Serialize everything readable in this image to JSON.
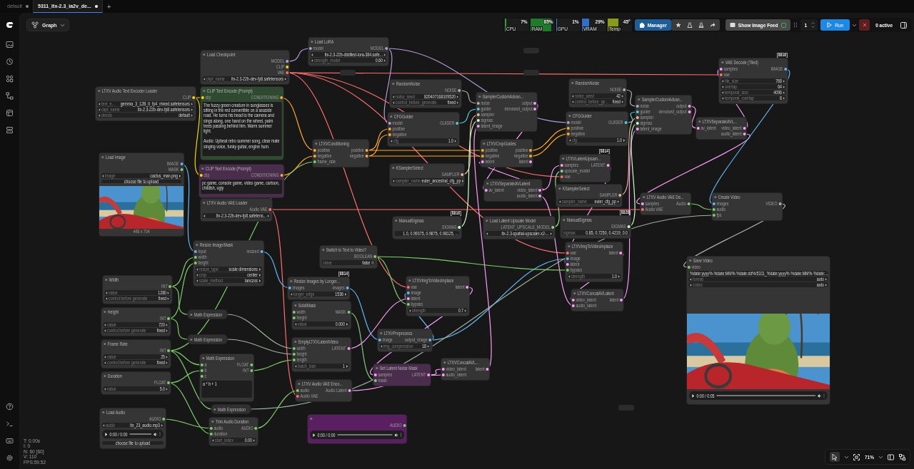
{
  "tabs": [
    {
      "label": "default",
      "selected": false,
      "modified": true
    },
    {
      "label": "5311_ltx-2.3_ia2v_de...",
      "selected": true,
      "modified": true
    }
  ],
  "new_tab": "+",
  "view_menu": {
    "label": "Graph"
  },
  "meters": [
    {
      "label": "CPU",
      "reading": "7%",
      "level": 0.07,
      "color": "#2e9e3e"
    },
    {
      "label": "RAM",
      "reading": "85%",
      "level": 0.85,
      "color": "#1f7a2a"
    },
    {
      "label": "GPU",
      "reading": "1%",
      "level": 0.01,
      "color": "#2f7fd6"
    },
    {
      "label": "VRAM",
      "reading": "29%",
      "level": 0.29,
      "color": "#2f6fc8"
    },
    {
      "label": "Temp",
      "reading": "45°",
      "level": 0.45,
      "color": "#8a9a1a"
    }
  ],
  "toolbar": {
    "manager": "Manager",
    "image_feed": "Show Image Feed",
    "queue_count": "1",
    "run": "Run",
    "active": "0 active"
  },
  "stats": [
    "T: 0.00s",
    "I: 0",
    "N: 60 [60]",
    "V: 110",
    "FPS:59.52"
  ],
  "zoom": "71%",
  "nodes": [
    {
      "title": "Load LoRA",
      "collapsed": false,
      "inputs": [
        {
          "name": "model",
          "color": "#b39ddb"
        }
      ],
      "outputs": [
        {
          "name": "MODEL",
          "color": "#b39ddb"
        }
      ],
      "widgets": [
        {
          "kind": "combo",
          "value": "ltx-2.3-22b-distilled-lora-384.safe..."
        },
        {
          "kind": "number",
          "label": "strength_model",
          "value": "0.60"
        }
      ]
    },
    {
      "title": "Load Checkpoint",
      "collapsed": false,
      "outputs": [
        {
          "name": "MODEL",
          "color": "#b39ddb"
        },
        {
          "name": "CLIP",
          "color": "#ffd500"
        },
        {
          "name": "VAE",
          "color": "#ff6e6e"
        }
      ],
      "widgets": [
        {
          "kind": "combo",
          "label": "ckpt_name",
          "value": "ltx-2.3-22b-dev-fp8.safetensors"
        }
      ]
    },
    {
      "title": "LTXV Audio Text Encoder Loader",
      "collapsed": false,
      "outputs": [
        {
          "name": "CLIP",
          "color": "#ffd500"
        }
      ],
      "widgets": [
        {
          "kind": "combo",
          "label": "text_e...",
          "value": "gemma_3_12B_it_fp4_mixed.safetensors"
        },
        {
          "kind": "combo",
          "label": "ckpt_name",
          "value": "ltx-2.3-22b-dev-fp8.safetensors"
        },
        {
          "kind": "combo",
          "label": "device",
          "value": "default"
        }
      ]
    },
    {
      "title": "CLIP Text Encode (Prompt)",
      "collapsed": false,
      "color": "#2f4a30",
      "inputs": [
        {
          "name": "clip",
          "color": "#ffd500"
        }
      ],
      "outputs": [
        {
          "name": "CONDITIONING",
          "color": "#ffa931"
        }
      ],
      "widgets": [
        {
          "kind": "text",
          "value": "The fuzzy green creature in sunglasses is sitting in the red convertible on a seaside road. He turns his head to the camera and sings along, one hand on the wheel, palm trees passing behind him. Warm summer light.\n\nAudio: Upbeat retro summer song, clear male singing voice, funky guitar, engine hum."
        }
      ]
    },
    {
      "title": "CLIP Text Encode (Prompt)",
      "collapsed": false,
      "color": "#4a2d4c",
      "inputs": [
        {
          "name": "clip",
          "color": "#ffd500"
        }
      ],
      "outputs": [
        {
          "name": "CONDITIONING",
          "color": "#ffa931"
        }
      ],
      "widgets": [
        {
          "kind": "text",
          "value": "pc game, console game, video game, cartoon, childish, ugly"
        }
      ]
    },
    {
      "title": "Load Image",
      "collapsed": false,
      "outputs": [
        {
          "name": "IMAGE",
          "color": "#64b5f6"
        },
        {
          "name": "MASK",
          "color": "#81c784"
        }
      ],
      "widgets": [
        {
          "kind": "combo",
          "label": "image",
          "value": "cactus_man.png"
        },
        {
          "kind": "button",
          "label": "choose file to upload"
        },
        {
          "kind": "picture"
        },
        {
          "kind": "caption",
          "value": "448 x 704"
        }
      ]
    },
    {
      "title": "LTXV Audio VAE Loader",
      "collapsed": false,
      "outputs": [
        {
          "name": "Audio VAE",
          "color": "#ff6e6e"
        }
      ],
      "widgets": [
        {
          "kind": "combo",
          "value": "ltx-2.3-22b-dev-fp8.safetens..."
        }
      ]
    },
    {
      "title": "LTXVConditioning",
      "collapsed": false,
      "inputs": [
        {
          "name": "positive",
          "color": "#ffa931"
        },
        {
          "name": "negative",
          "color": "#ffa931"
        },
        {
          "name": "frame_rate",
          "color": "#7ccf6a"
        }
      ],
      "outputs": [
        {
          "name": "positive",
          "color": "#ffa931"
        },
        {
          "name": "negative",
          "color": "#ffa931"
        }
      ]
    },
    {
      "title": "RandomNoise",
      "collapsed": false,
      "outputs": [
        {
          "name": "NOISE",
          "color": "#b0b0b0"
        }
      ],
      "widgets": [
        {
          "kind": "number",
          "label": "noise_seed",
          "value": "820407168109520"
        },
        {
          "kind": "combo",
          "label": "control_before_generate",
          "value": "fixed"
        }
      ]
    },
    {
      "title": "CFGGuider",
      "collapsed": false,
      "inputs": [
        {
          "name": "model",
          "color": "#b39ddb"
        },
        {
          "name": "positive",
          "color": "#ffa931"
        },
        {
          "name": "negative",
          "color": "#ffa931"
        }
      ],
      "outputs": [
        {
          "name": "GUIDER",
          "color": "#56c8d8"
        }
      ],
      "widgets": [
        {
          "kind": "number",
          "label": "cfg",
          "value": "1.0"
        }
      ]
    },
    {
      "title": "SamplerCustomAdvan...",
      "collapsed": false,
      "inputs": [
        {
          "name": "noise",
          "color": "#b0b0b0"
        },
        {
          "name": "guider",
          "color": "#56c8d8"
        },
        {
          "name": "sampler",
          "color": "#e8b89a"
        },
        {
          "name": "sigmas",
          "color": "#cdffcd"
        },
        {
          "name": "latent_image",
          "color": "#ff9cf9"
        }
      ],
      "outputs": [
        {
          "name": "output",
          "color": "#ff9cf9"
        },
        {
          "name": "denoised_output",
          "color": "#ff9cf9"
        }
      ]
    },
    {
      "title": "LTXVCropGuides",
      "collapsed": false,
      "inputs": [
        {
          "name": "positive",
          "color": "#ffa931"
        },
        {
          "name": "negative",
          "color": "#ffa931"
        },
        {
          "name": "latent",
          "color": "#ff9cf9"
        }
      ],
      "outputs": [
        {
          "name": "positive",
          "color": "#ffa931"
        },
        {
          "name": "negative",
          "color": "#ffa931"
        },
        {
          "name": "latent",
          "color": "#ff9cf9"
        }
      ]
    },
    {
      "title": "KSamplerSelect",
      "collapsed": false,
      "outputs": [
        {
          "name": "SAMPLER",
          "color": "#e8b89a"
        }
      ],
      "widgets": [
        {
          "kind": "combo",
          "label": "sampler_name",
          "value": "euler_ancestral_cfg_pp"
        }
      ]
    },
    {
      "title": "LTXVSeparateAVLatent",
      "collapsed": false,
      "inputs": [
        {
          "name": "av_latent",
          "color": "#ff9cf9"
        }
      ],
      "outputs": [
        {
          "name": "video_latent",
          "color": "#ff9cf9"
        },
        {
          "name": "audio_latent",
          "color": "#ff9cf9"
        }
      ]
    },
    {
      "title": "ManualSigmas",
      "badge": "[8816]",
      "collapsed": false,
      "outputs": [
        {
          "name": "SIGMAS",
          "color": "#cdffcd"
        }
      ],
      "widgets": [
        {
          "kind": "input",
          "value": "1.0, 0.99375, 0.9875, 0.98125, ..."
        }
      ]
    },
    {
      "title": "Load Latent Upscale Model",
      "collapsed": false,
      "outputs": [
        {
          "name": "LATENT_UPSCALE_MODEL",
          "color": "#88d888"
        }
      ],
      "widgets": [
        {
          "kind": "combo",
          "value": "ltx-2.3-spatial-upscaler-x2-..."
        }
      ]
    },
    {
      "title": "RandomNoise",
      "collapsed": false,
      "outputs": [
        {
          "name": "NOISE",
          "color": "#b0b0b0"
        }
      ],
      "widgets": [
        {
          "kind": "number",
          "label": "noise_seed",
          "value": "42"
        },
        {
          "kind": "combo",
          "label": "control_before_ge...",
          "value": "fixed"
        }
      ]
    },
    {
      "title": "CFGGuider",
      "collapsed": false,
      "inputs": [
        {
          "name": "model",
          "color": "#b39ddb"
        },
        {
          "name": "positive",
          "color": "#ffa931"
        },
        {
          "name": "negative",
          "color": "#ffa931"
        }
      ],
      "outputs": [
        {
          "name": "GUIDER",
          "color": "#56c8d8"
        }
      ],
      "widgets": [
        {
          "kind": "number",
          "label": "cfg",
          "value": "1.0"
        }
      ]
    },
    {
      "title": "SamplerCustomAdvan...",
      "collapsed": false,
      "inputs": [
        {
          "name": "noise",
          "color": "#b0b0b0"
        },
        {
          "name": "guider",
          "color": "#56c8d8"
        },
        {
          "name": "sampler",
          "color": "#e8b89a"
        },
        {
          "name": "sigmas",
          "color": "#cdffcd"
        },
        {
          "name": "latent_image",
          "color": "#ff9cf9"
        }
      ],
      "outputs": [
        {
          "name": "output",
          "color": "#ff9cf9"
        },
        {
          "name": "denoised_output",
          "color": "#ff9cf9"
        }
      ]
    },
    {
      "title": "LTXVSeparateAVL...",
      "collapsed": false,
      "inputs": [
        {
          "name": "av_latent",
          "color": "#ff9cf9"
        }
      ],
      "outputs": [
        {
          "name": "video_latent",
          "color": "#ff9cf9"
        },
        {
          "name": "audio_latent",
          "color": "#ff9cf9"
        }
      ]
    },
    {
      "title": "VAE Decode (Tiled)",
      "badge": "[8816]",
      "collapsed": false,
      "inputs": [
        {
          "name": "samples",
          "color": "#ff9cf9"
        },
        {
          "name": "vae",
          "color": "#ff6e6e"
        }
      ],
      "outputs": [
        {
          "name": "IMAGE",
          "color": "#64b5f6"
        }
      ],
      "widgets": [
        {
          "kind": "number",
          "label": "tile_size",
          "value": "768"
        },
        {
          "kind": "number",
          "label": "overlap",
          "value": "64"
        },
        {
          "kind": "number",
          "label": "temporal_size",
          "value": "4096"
        },
        {
          "kind": "number",
          "label": "temporal_overlap",
          "value": "8"
        }
      ]
    },
    {
      "title": "LTXVLatentUpsam...",
      "badge": "[8814]",
      "collapsed": false,
      "inputs": [
        {
          "name": "samples",
          "color": "#ff9cf9"
        },
        {
          "name": "upscale_model",
          "color": "#88d888"
        },
        {
          "name": "vae",
          "color": "#ff6e6e"
        }
      ],
      "outputs": [
        {
          "name": "LATENT",
          "color": "#ff9cf9"
        }
      ]
    },
    {
      "title": "KSamplerSelect",
      "collapsed": false,
      "outputs": [
        {
          "name": "SAMPLER",
          "color": "#e8b89a"
        }
      ],
      "widgets": [
        {
          "kind": "combo",
          "label": "sampler_name",
          "value": "euler_cfg_pp"
        }
      ]
    },
    {
      "title": "ManualSigmas",
      "badge": "[8826]",
      "collapsed": false,
      "outputs": [
        {
          "name": "SIGMAS",
          "color": "#cdffcd"
        }
      ],
      "widgets": [
        {
          "kind": "input",
          "label": "sigmas",
          "value": "0.85, 0.7250, 0.4219, 0.0"
        }
      ]
    },
    {
      "title": "LTXV Audio VAE De...",
      "collapsed": false,
      "inputs": [
        {
          "name": "samples",
          "color": "#ff9cf9"
        },
        {
          "name": "Audio VAE",
          "color": "#ff6e6e"
        }
      ],
      "outputs": [
        {
          "name": "Audio",
          "color": "#7ccf6a"
        }
      ]
    },
    {
      "title": "Create Video",
      "collapsed": false,
      "inputs": [
        {
          "name": "images",
          "color": "#64b5f6"
        },
        {
          "name": "audio",
          "color": "#7ccf6a"
        },
        {
          "name": "fps",
          "color": "#7ccf6a"
        }
      ],
      "outputs": [
        {
          "name": "VIDEO",
          "color": "#b0b0b0"
        }
      ]
    },
    {
      "title": "LTXVImgToVideoInplace",
      "collapsed": false,
      "inputs": [
        {
          "name": "vae",
          "color": "#ff6e6e"
        },
        {
          "name": "image",
          "color": "#64b5f6"
        },
        {
          "name": "latent",
          "color": "#ff9cf9"
        },
        {
          "name": "bypass",
          "color": "#7ccf6a"
        }
      ],
      "outputs": [
        {
          "name": "latent",
          "color": "#ff9cf9"
        }
      ],
      "widgets": [
        {
          "kind": "number",
          "label": "strength",
          "value": "1.0"
        }
      ]
    },
    {
      "title": "LTXVConcatAVLatent",
      "collapsed": false,
      "inputs": [
        {
          "name": "video_latent",
          "color": "#ff9cf9"
        },
        {
          "name": "audio_latent",
          "color": "#ff9cf9"
        }
      ],
      "outputs": [
        {
          "name": "latent",
          "color": "#ff9cf9"
        }
      ]
    },
    {
      "title": "Save Video",
      "collapsed": false,
      "inputs": [
        {
          "name": "video",
          "color": "#7ccf6a"
        }
      ],
      "widgets": [
        {
          "kind": "input",
          "value": "%date:yyyy%-%date:MM%-%date:dd%/5311_%date:yyyy%-%date:MM%-%date:..."
        },
        {
          "kind": "combo",
          "label": "format",
          "value": "auto"
        },
        {
          "kind": "combo",
          "label": "codec",
          "value": "auto"
        },
        {
          "kind": "picture"
        },
        {
          "kind": "player",
          "time": "0:00 / 0:05"
        }
      ]
    },
    {
      "title": "Resize Image/Mask",
      "collapsed": false,
      "inputs": [
        {
          "name": "input",
          "color": "#64b5f6"
        },
        {
          "name": "width",
          "color": "#7ccf6a"
        },
        {
          "name": "height",
          "color": "#7ccf6a"
        }
      ],
      "outputs": [
        {
          "name": "resized",
          "color": "#64b5f6"
        }
      ],
      "widgets": [
        {
          "kind": "combo",
          "label": "resize_type",
          "value": "scale dimensions"
        },
        {
          "kind": "combo",
          "label": "crop",
          "value": "center"
        },
        {
          "kind": "combo",
          "label": "scale_method",
          "value": "lanczos"
        }
      ]
    },
    {
      "title": "Switch to Text to Video?",
      "collapsed": false,
      "outputs": [
        {
          "name": "BOOLEAN",
          "color": "#7ccf6a"
        }
      ],
      "widgets": [
        {
          "kind": "toggle",
          "label": "value",
          "value": "false",
          "on": false
        }
      ]
    },
    {
      "title": "Resize Images by Longer...",
      "badge": "[8814]",
      "collapsed": false,
      "inputs": [
        {
          "name": "images",
          "color": "#64b5f6"
        }
      ],
      "outputs": [
        {
          "name": "images",
          "color": "#64b5f6"
        }
      ],
      "widgets": [
        {
          "kind": "number",
          "label": "longer_edge",
          "value": "1536"
        }
      ]
    },
    {
      "title": "SolidMask",
      "collapsed": false,
      "inputs": [
        {
          "name": "width",
          "color": "#7ccf6a"
        },
        {
          "name": "height",
          "color": "#7ccf6a"
        }
      ],
      "outputs": [
        {
          "name": "MASK",
          "color": "#81c784"
        }
      ],
      "widgets": [
        {
          "kind": "number",
          "label": "value",
          "value": "0.000"
        }
      ]
    },
    {
      "title": "EmptyLTXVLatentVideo",
      "collapsed": false,
      "inputs": [
        {
          "name": "width",
          "color": "#7ccf6a"
        },
        {
          "name": "height",
          "color": "#7ccf6a"
        },
        {
          "name": "length",
          "color": "#7ccf6a"
        }
      ],
      "outputs": [
        {
          "name": "LATENT",
          "color": "#ff9cf9"
        }
      ],
      "widgets": [
        {
          "kind": "number",
          "label": "batch_size",
          "value": "1"
        }
      ]
    },
    {
      "title": "LTXVImgToVideoInplace",
      "collapsed": false,
      "inputs": [
        {
          "name": "vae",
          "color": "#ff6e6e"
        },
        {
          "name": "image",
          "color": "#64b5f6"
        },
        {
          "name": "latent",
          "color": "#ff9cf9"
        },
        {
          "name": "bypass",
          "color": "#7ccf6a"
        }
      ],
      "outputs": [
        {
          "name": "latent",
          "color": "#ff9cf9"
        }
      ],
      "widgets": [
        {
          "kind": "number",
          "label": "strength",
          "value": "0.7"
        }
      ]
    },
    {
      "title": "LTXVPreprocess",
      "collapsed": false,
      "inputs": [
        {
          "name": "image",
          "color": "#64b5f6"
        }
      ],
      "outputs": [
        {
          "name": "output_image",
          "color": "#64b5f6"
        }
      ],
      "widgets": [
        {
          "kind": "number",
          "label": "img_compression",
          "value": "18"
        }
      ]
    },
    {
      "title": "Set Latent Noise Mask",
      "collapsed": false,
      "color": "#4a2d4c",
      "inputs": [
        {
          "name": "samples",
          "color": "#ff9cf9"
        },
        {
          "name": "mask",
          "color": "#81c784"
        }
      ],
      "outputs": [
        {
          "name": "LATENT",
          "color": "#ff9cf9"
        }
      ]
    },
    {
      "title": "LTXVConcatAVL...",
      "collapsed": false,
      "inputs": [
        {
          "name": "video_latent",
          "color": "#ff9cf9"
        },
        {
          "name": "audio_latent",
          "color": "#ff9cf9"
        }
      ],
      "outputs": [
        {
          "name": "latent",
          "color": "#ff9cf9"
        }
      ]
    },
    {
      "title": "LTXV Audio VAE Enco...",
      "collapsed": false,
      "inputs": [
        {
          "name": "audio",
          "color": "#7ccf6a"
        },
        {
          "name": "Audio VAE",
          "color": "#ff6e6e"
        }
      ],
      "outputs": [
        {
          "name": "Audio Latent",
          "color": "#ff9cf9"
        }
      ]
    },
    {
      "title": "Width",
      "collapsed": false,
      "outputs": [
        {
          "name": "INT",
          "color": "#7ccf6a"
        }
      ],
      "widgets": [
        {
          "kind": "number",
          "label": "value",
          "value": "1280"
        },
        {
          "kind": "combo",
          "label": "control before generate",
          "value": "fixed"
        }
      ]
    },
    {
      "title": "Height",
      "collapsed": false,
      "outputs": [
        {
          "name": "INT",
          "color": "#7ccf6a"
        }
      ],
      "widgets": [
        {
          "kind": "number",
          "label": "value",
          "value": "720"
        },
        {
          "kind": "combo",
          "label": "control before generate",
          "value": "fixed"
        }
      ]
    },
    {
      "title": "Frame Rate",
      "collapsed": false,
      "outputs": [
        {
          "name": "INT",
          "color": "#7ccf6a"
        }
      ],
      "widgets": [
        {
          "kind": "number",
          "label": "value",
          "value": "25"
        },
        {
          "kind": "combo",
          "label": "control before generate",
          "value": "fixed"
        }
      ]
    },
    {
      "title": "Duration",
      "collapsed": false,
      "outputs": [
        {
          "name": "FLOAT",
          "color": "#7ccf6a"
        }
      ],
      "widgets": [
        {
          "kind": "number",
          "label": "value",
          "value": "5.0"
        }
      ]
    },
    {
      "title": "Math Expression",
      "collapsed": true
    },
    {
      "title": "Math Expression",
      "collapsed": true
    },
    {
      "title": "Math Expression",
      "collapsed": false,
      "inputs": [
        {
          "name": "a",
          "color": "#7ccf6a"
        },
        {
          "name": "b",
          "color": "#7ccf6a"
        },
        {
          "name": "c",
          "color": "#7ccf6a"
        }
      ],
      "outputs": [
        {
          "name": "FLOAT",
          "color": "#7ccf6a"
        },
        {
          "name": "INT",
          "color": "#7ccf6a"
        }
      ],
      "widgets": [
        {
          "kind": "text",
          "value": "a * b + 1"
        }
      ]
    },
    {
      "title": "Math Expression",
      "collapsed": true
    },
    {
      "title": "Load Audio",
      "collapsed": false,
      "outputs": [
        {
          "name": "AUDIO",
          "color": "#7ccf6a"
        }
      ],
      "widgets": [
        {
          "kind": "combo",
          "label": "audio",
          "value": "ltx_23_audio.mp3"
        },
        {
          "kind": "player",
          "time": "0:00 / 0:00"
        },
        {
          "kind": "button",
          "label": "choose file to upload"
        }
      ]
    },
    {
      "title": "Trim Audio Duration",
      "collapsed": false,
      "inputs": [
        {
          "name": "audio",
          "color": "#7ccf6a"
        },
        {
          "name": "duration",
          "color": "#7ccf6a"
        }
      ],
      "outputs": [
        {
          "name": "AUDIO",
          "color": "#7ccf6a"
        }
      ],
      "widgets": [
        {
          "kind": "number",
          "label": "start_index",
          "value": "0.00"
        }
      ]
    },
    {
      "collapsed": false,
      "color": "#5a1f60",
      "outputs": [
        {
          "name": "AUDIO",
          "color": "#7ccf6a"
        }
      ],
      "widgets": [
        {
          "kind": "player",
          "time": "0:00 / 0:00"
        }
      ]
    }
  ]
}
